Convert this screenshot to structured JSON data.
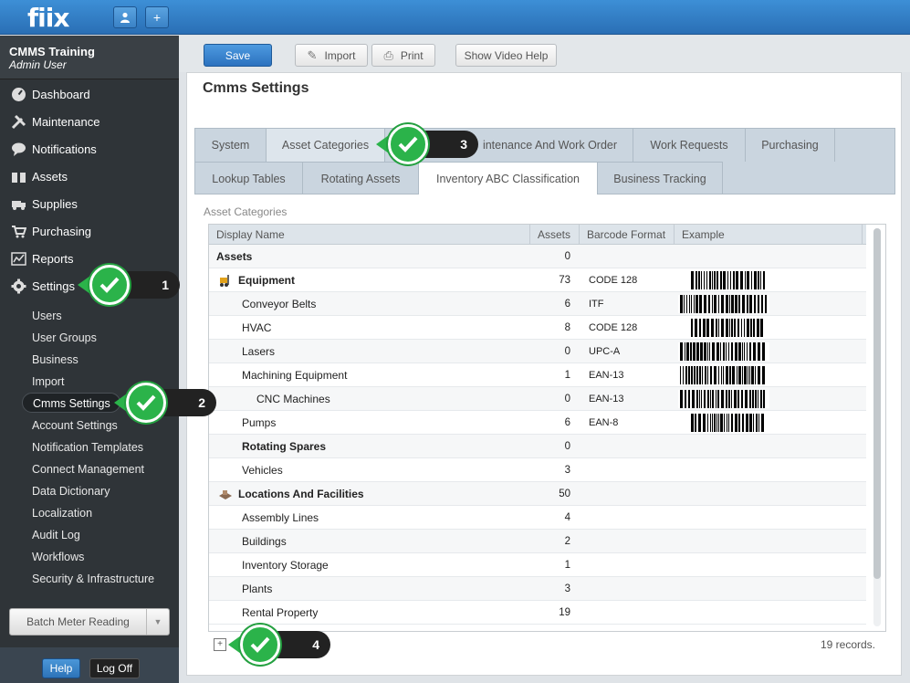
{
  "app": {
    "logo": "fiix",
    "top_buttons": [
      "user-icon",
      "plus-icon"
    ],
    "plus_glyph": "+"
  },
  "sidebar": {
    "org": "CMMS Training",
    "user": "Admin User",
    "items": [
      {
        "label": "Dashboard",
        "icon": "dashboard-icon"
      },
      {
        "label": "Maintenance",
        "icon": "tools-icon"
      },
      {
        "label": "Notifications",
        "icon": "chat-icon"
      },
      {
        "label": "Assets",
        "icon": "boxes-icon"
      },
      {
        "label": "Supplies",
        "icon": "truck-icon"
      },
      {
        "label": "Purchasing",
        "icon": "cart-icon"
      },
      {
        "label": "Reports",
        "icon": "chart-icon"
      },
      {
        "label": "Settings",
        "icon": "gear-icon"
      }
    ],
    "sub_items": [
      "Users",
      "User Groups",
      "Business",
      "Import",
      "Cmms Settings",
      "Account Settings",
      "Notification Templates",
      "Connect Management",
      "Data Dictionary",
      "Localization",
      "Audit Log",
      "Workflows",
      "Security & Infrastructure"
    ],
    "active_sub": "Cmms Settings",
    "batch_button": "Batch Meter Reading",
    "help": "Help",
    "logoff": "Log Off"
  },
  "toolbar": {
    "save": "Save",
    "import": "Import",
    "print": "Print",
    "video_help": "Show Video Help"
  },
  "page": {
    "title": "Cmms Settings",
    "tabs_row1": [
      "System",
      "Asset Categories",
      "Maintenance And Work Order",
      "Work Requests",
      "Purchasing"
    ],
    "tab1_visible_text": "intenance And Work Order",
    "tabs_row2": [
      "Lookup Tables",
      "Rotating Assets",
      "Inventory ABC Classification",
      "Business Tracking"
    ],
    "selected_tabs": [
      "Asset Categories",
      "Inventory ABC Classification"
    ],
    "section_label": "Asset Categories",
    "columns": [
      "Display Name",
      "Assets",
      "Barcode Format",
      "Example"
    ],
    "rows": [
      {
        "name": "Assets",
        "assets": "0",
        "code": "",
        "level": 0,
        "bold": true,
        "icon": ""
      },
      {
        "name": "Equipment",
        "assets": "73",
        "code": "CODE 128",
        "level": 0,
        "bold": true,
        "icon": "forklift-icon"
      },
      {
        "name": "Conveyor Belts",
        "assets": "6",
        "code": "ITF",
        "level": 1,
        "bold": false,
        "icon": ""
      },
      {
        "name": "HVAC",
        "assets": "8",
        "code": "CODE 128",
        "level": 1,
        "bold": false,
        "icon": ""
      },
      {
        "name": "Lasers",
        "assets": "0",
        "code": "UPC-A",
        "level": 1,
        "bold": false,
        "icon": ""
      },
      {
        "name": "Machining Equipment",
        "assets": "1",
        "code": "EAN-13",
        "level": 1,
        "bold": false,
        "icon": ""
      },
      {
        "name": "CNC Machines",
        "assets": "0",
        "code": "EAN-13",
        "level": 2,
        "bold": false,
        "icon": ""
      },
      {
        "name": "Pumps",
        "assets": "6",
        "code": "EAN-8",
        "level": 1,
        "bold": false,
        "icon": ""
      },
      {
        "name": "Rotating Spares",
        "assets": "0",
        "code": "",
        "level": 1,
        "bold": true,
        "icon": ""
      },
      {
        "name": "Vehicles",
        "assets": "3",
        "code": "",
        "level": 1,
        "bold": false,
        "icon": ""
      },
      {
        "name": "Locations And Facilities",
        "assets": "50",
        "code": "",
        "level": 0,
        "bold": true,
        "icon": "building-icon"
      },
      {
        "name": "Assembly Lines",
        "assets": "4",
        "code": "",
        "level": 1,
        "bold": false,
        "icon": ""
      },
      {
        "name": "Buildings",
        "assets": "2",
        "code": "",
        "level": 1,
        "bold": false,
        "icon": ""
      },
      {
        "name": "Inventory Storage",
        "assets": "1",
        "code": "",
        "level": 1,
        "bold": false,
        "icon": ""
      },
      {
        "name": "Plants",
        "assets": "3",
        "code": "",
        "level": 1,
        "bold": false,
        "icon": ""
      },
      {
        "name": "Rental Property",
        "assets": "19",
        "code": "",
        "level": 1,
        "bold": false,
        "icon": ""
      }
    ],
    "records": "19 records."
  },
  "callouts": [
    "1",
    "2",
    "3",
    "4"
  ],
  "colors": {
    "brand_blue": "#2a6fb5",
    "sidebar": "#2f3438",
    "callout_green": "#2bb34a",
    "callout_dark": "#222222"
  }
}
